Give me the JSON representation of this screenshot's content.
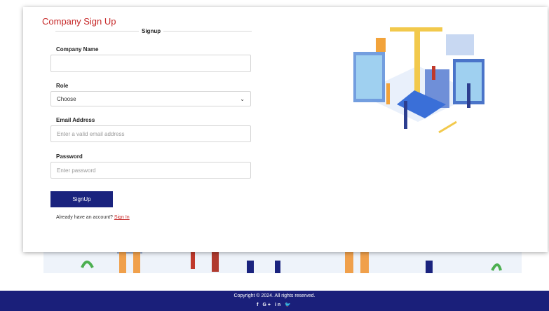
{
  "form": {
    "title": "Company Sign Up",
    "tab": "Signup",
    "company_name_label": "Company Name",
    "company_name_value": "",
    "role_label": "Role",
    "role_value": "Choose",
    "email_label": "Email Address",
    "email_placeholder": "Enter a valid email address",
    "password_label": "Password",
    "password_placeholder": "Enter password",
    "submit_label": "SignUp",
    "have_account_text": "Already have an account?",
    "signin_link": "Sign In"
  },
  "footer": {
    "copyright": "Copyright © 2024. All rights reserved.",
    "socials": [
      "f",
      "G+",
      "in",
      "🐦"
    ]
  },
  "colors": {
    "title": "#c62828",
    "primary": "#1a237e",
    "footer": "#1a1f7a"
  },
  "icons": {
    "select": "chevron-down-icon",
    "illustration": "isometric-construction-illustration"
  }
}
